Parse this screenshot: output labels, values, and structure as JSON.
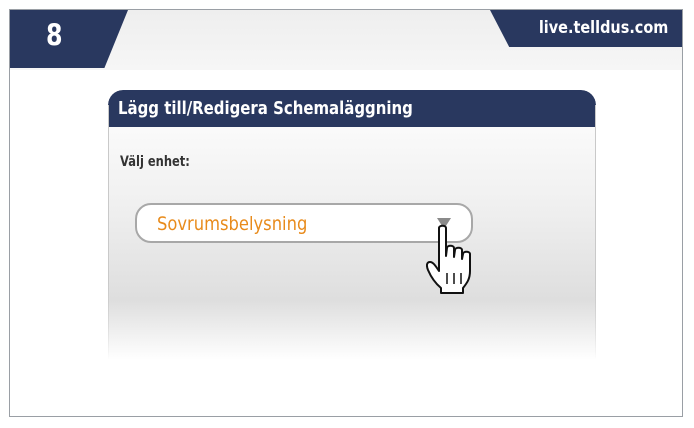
{
  "step": {
    "number": "8"
  },
  "site": {
    "url": "live.telldus.com"
  },
  "dialog": {
    "title": "Lägg till/Redigera Schemaläggning",
    "device_label": "Välj enhet:",
    "device_select": {
      "selected_value": "Sovrumsbelysning",
      "arrow_icon": "triangle-down-icon"
    }
  },
  "cursor": {
    "icon": "hand-pointer-icon"
  },
  "colors": {
    "navy": "#29385f",
    "selected_text": "#e88b1c",
    "frame_border": "#9a9fa5"
  }
}
